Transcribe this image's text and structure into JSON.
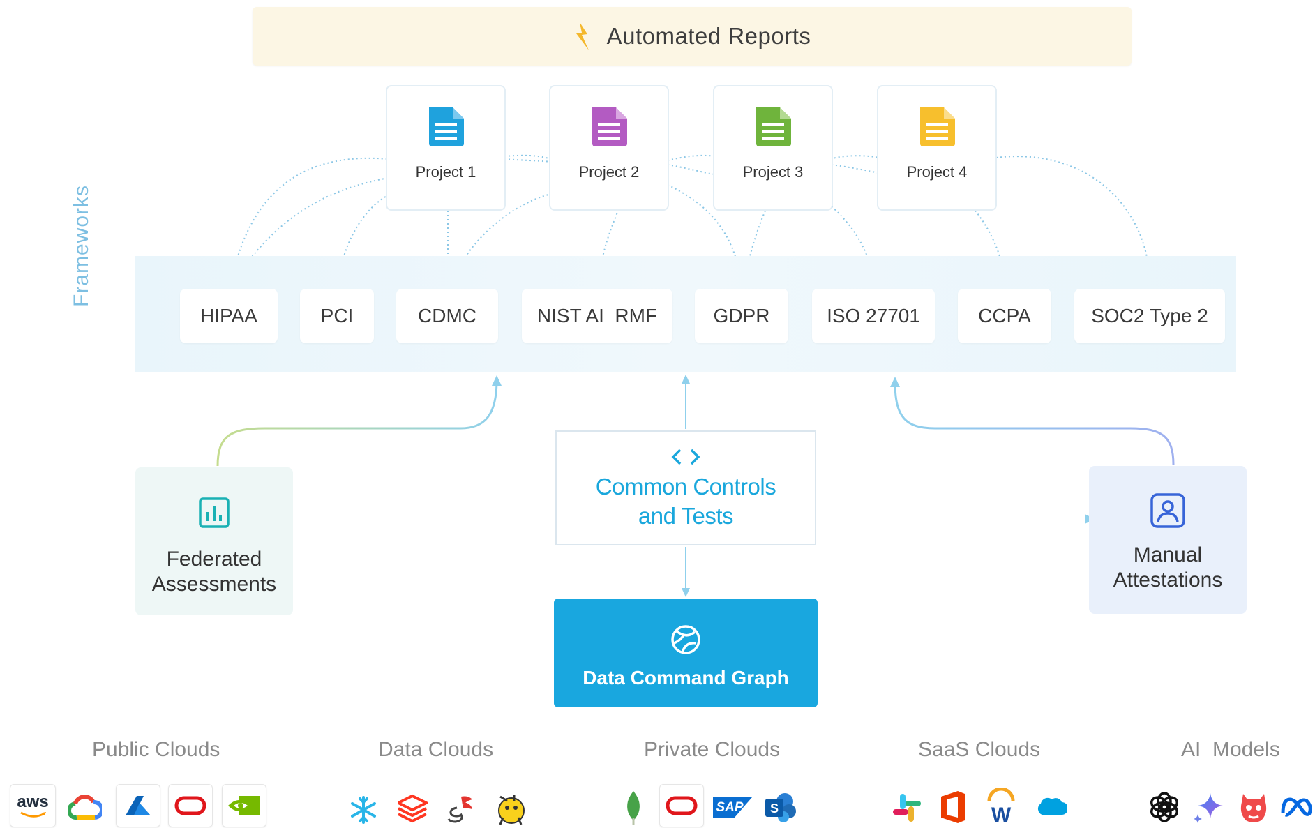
{
  "banner": {
    "title": "Automated Reports"
  },
  "projects": [
    {
      "label": "Project 1",
      "color": "#1fa2dd"
    },
    {
      "label": "Project 2",
      "color": "#b35bc2"
    },
    {
      "label": "Project 3",
      "color": "#6fb43c"
    },
    {
      "label": "Project 4",
      "color": "#f7bf2d"
    }
  ],
  "frameworks": {
    "label": "Frameworks",
    "items": [
      "HIPAA",
      "PCI",
      "CDMC",
      "NIST AI  RMF",
      "GDPR",
      "ISO 27701",
      "CCPA",
      "SOC2 Type 2"
    ]
  },
  "federated": {
    "line1": "Federated",
    "line2": "Assessments"
  },
  "common_controls": {
    "line1": "Common Controls",
    "line2": "and Tests"
  },
  "data_command_graph": {
    "title": "Data Command Graph"
  },
  "manual": {
    "line1": "Manual",
    "line2": "Attestations"
  },
  "categories": [
    "Public Clouds",
    "Data Clouds",
    "Private Clouds",
    "SaaS Clouds",
    "AI  Models"
  ],
  "logos": {
    "aws": "aws",
    "sap": "SAP",
    "colors": {
      "accent": "#1aa7dc",
      "oracle": "#e0161b",
      "nvidia": "#76b900"
    }
  }
}
